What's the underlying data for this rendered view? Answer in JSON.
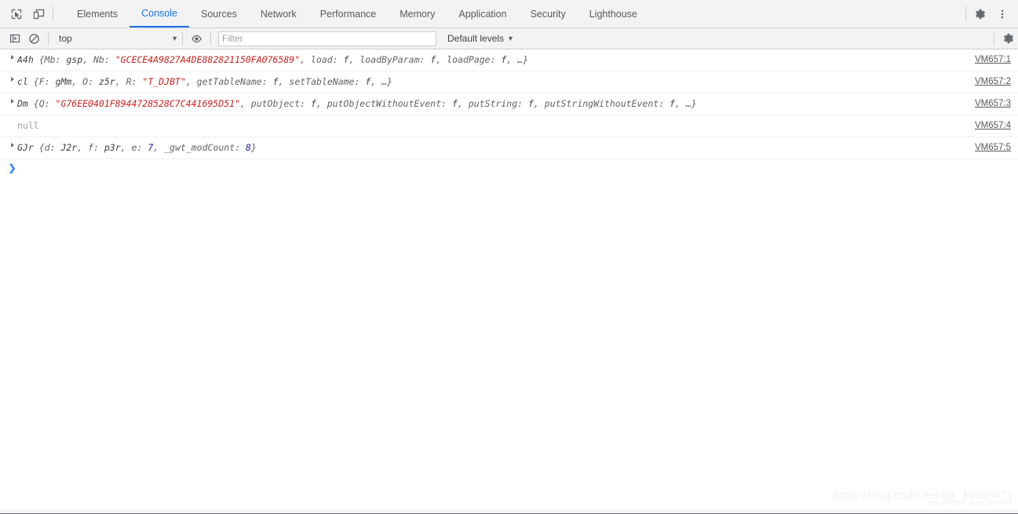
{
  "window": {
    "accent_color": "#1a73e8",
    "toolbar_bg": "#f3f3f3",
    "string_color": "#c5221f",
    "number_color": "#1a1aa6"
  },
  "tabbar": {
    "inspect_icon": "inspect-element-icon",
    "device_icon": "device-toolbar-icon",
    "settings_icon": "gear-icon",
    "more_icon": "kebab-menu-icon",
    "tabs": [
      {
        "label": "Elements",
        "active": false
      },
      {
        "label": "Console",
        "active": true
      },
      {
        "label": "Sources",
        "active": false
      },
      {
        "label": "Network",
        "active": false
      },
      {
        "label": "Performance",
        "active": false
      },
      {
        "label": "Memory",
        "active": false
      },
      {
        "label": "Application",
        "active": false
      },
      {
        "label": "Security",
        "active": false
      },
      {
        "label": "Lighthouse",
        "active": false
      }
    ]
  },
  "console_toolbar": {
    "sidebar_icon": "show-console-sidebar-icon",
    "clear_icon": "clear-console-icon",
    "eye_icon": "live-expression-eye-icon",
    "settings_icon": "gear-icon",
    "context": "top",
    "context_caret": "▼",
    "filter_placeholder": "Filter",
    "filter_value": "",
    "levels_label": "Default levels",
    "levels_caret": "▼"
  },
  "messages": [
    {
      "expandable": true,
      "source": "VM657:1",
      "parts": [
        {
          "t": "cls",
          "v": "A4h"
        },
        {
          "t": "punct",
          "v": " {"
        },
        {
          "t": "k",
          "v": "Mb"
        },
        {
          "t": "punct",
          "v": ": "
        },
        {
          "t": "fn",
          "v": "gsp"
        },
        {
          "t": "punct",
          "v": ", "
        },
        {
          "t": "k",
          "v": "Nb"
        },
        {
          "t": "punct",
          "v": ": "
        },
        {
          "t": "str",
          "v": "\"GCECE4A9827A4DE882821150FA076589\""
        },
        {
          "t": "punct",
          "v": ", "
        },
        {
          "t": "k",
          "v": "load"
        },
        {
          "t": "punct",
          "v": ": "
        },
        {
          "t": "fn",
          "v": "f"
        },
        {
          "t": "punct",
          "v": ", "
        },
        {
          "t": "k",
          "v": "loadByParam"
        },
        {
          "t": "punct",
          "v": ": "
        },
        {
          "t": "fn",
          "v": "f"
        },
        {
          "t": "punct",
          "v": ", "
        },
        {
          "t": "k",
          "v": "loadPage"
        },
        {
          "t": "punct",
          "v": ": "
        },
        {
          "t": "fn",
          "v": "f"
        },
        {
          "t": "punct",
          "v": ", …}"
        }
      ]
    },
    {
      "expandable": true,
      "source": "VM657:2",
      "parts": [
        {
          "t": "cls",
          "v": "cl"
        },
        {
          "t": "punct",
          "v": " {"
        },
        {
          "t": "k",
          "v": "F"
        },
        {
          "t": "punct",
          "v": ": "
        },
        {
          "t": "fn",
          "v": "gMm"
        },
        {
          "t": "punct",
          "v": ", "
        },
        {
          "t": "k",
          "v": "O"
        },
        {
          "t": "punct",
          "v": ": "
        },
        {
          "t": "fn",
          "v": "z5r"
        },
        {
          "t": "punct",
          "v": ", "
        },
        {
          "t": "k",
          "v": "R"
        },
        {
          "t": "punct",
          "v": ": "
        },
        {
          "t": "str",
          "v": "\"T_DJBT\""
        },
        {
          "t": "punct",
          "v": ", "
        },
        {
          "t": "k",
          "v": "getTableName"
        },
        {
          "t": "punct",
          "v": ": "
        },
        {
          "t": "fn",
          "v": "f"
        },
        {
          "t": "punct",
          "v": ", "
        },
        {
          "t": "k",
          "v": "setTableName"
        },
        {
          "t": "punct",
          "v": ": "
        },
        {
          "t": "fn",
          "v": "f"
        },
        {
          "t": "punct",
          "v": ", …}"
        }
      ]
    },
    {
      "expandable": true,
      "source": "VM657:3",
      "parts": [
        {
          "t": "cls",
          "v": "Dm"
        },
        {
          "t": "punct",
          "v": " {"
        },
        {
          "t": "k",
          "v": "Q"
        },
        {
          "t": "punct",
          "v": ": "
        },
        {
          "t": "str",
          "v": "\"G76EE0401F8944728528C7C441695D51\""
        },
        {
          "t": "punct",
          "v": ", "
        },
        {
          "t": "k",
          "v": "putObject"
        },
        {
          "t": "punct",
          "v": ": "
        },
        {
          "t": "fn",
          "v": "f"
        },
        {
          "t": "punct",
          "v": ", "
        },
        {
          "t": "k",
          "v": "putObjectWithoutEvent"
        },
        {
          "t": "punct",
          "v": ": "
        },
        {
          "t": "fn",
          "v": "f"
        },
        {
          "t": "punct",
          "v": ", "
        },
        {
          "t": "k",
          "v": "putString"
        },
        {
          "t": "punct",
          "v": ": "
        },
        {
          "t": "fn",
          "v": "f"
        },
        {
          "t": "punct",
          "v": ", "
        },
        {
          "t": "k",
          "v": "putStringWithoutEvent"
        },
        {
          "t": "punct",
          "v": ": "
        },
        {
          "t": "fn",
          "v": "f"
        },
        {
          "t": "punct",
          "v": ", …}"
        }
      ]
    },
    {
      "expandable": false,
      "source": "VM657:4",
      "parts": [
        {
          "t": "nullval",
          "v": "null"
        }
      ]
    },
    {
      "expandable": true,
      "source": "VM657:5",
      "parts": [
        {
          "t": "cls",
          "v": "GJr"
        },
        {
          "t": "punct",
          "v": " {"
        },
        {
          "t": "k",
          "v": "d"
        },
        {
          "t": "punct",
          "v": ": "
        },
        {
          "t": "fn",
          "v": "J2r"
        },
        {
          "t": "punct",
          "v": ", "
        },
        {
          "t": "k",
          "v": "f"
        },
        {
          "t": "punct",
          "v": ": "
        },
        {
          "t": "fn",
          "v": "p3r"
        },
        {
          "t": "punct",
          "v": ", "
        },
        {
          "t": "k",
          "v": "e"
        },
        {
          "t": "punct",
          "v": ": "
        },
        {
          "t": "num",
          "v": "7"
        },
        {
          "t": "punct",
          "v": ", "
        },
        {
          "t": "k",
          "v": "_gwt_modCount"
        },
        {
          "t": "punct",
          "v": ": "
        },
        {
          "t": "num",
          "v": "8"
        },
        {
          "t": "punct",
          "v": "}"
        }
      ]
    }
  ],
  "prompt": {
    "chevron": "❯",
    "value": ""
  },
  "watermark": {
    "text": "https://blog.csdn.net/qq_34955471"
  }
}
